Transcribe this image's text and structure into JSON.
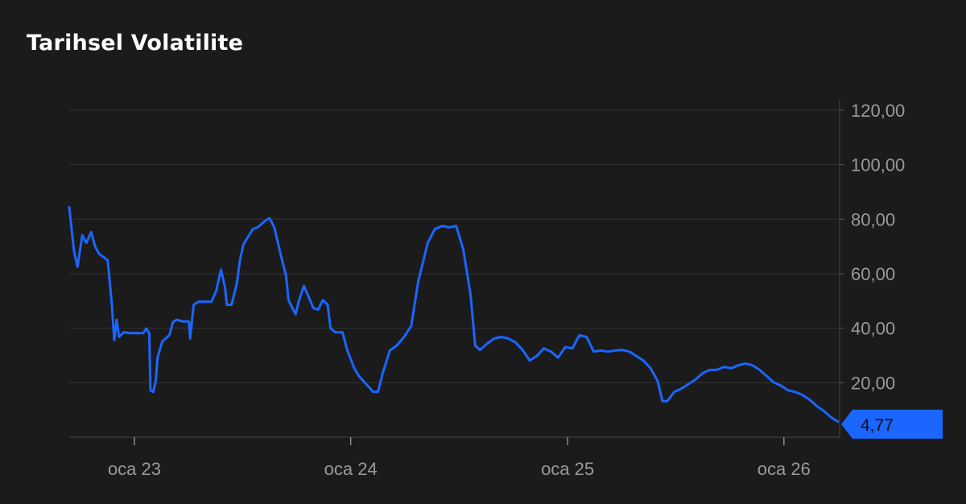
{
  "chart_data": {
    "type": "line",
    "title": "Tarihsel Volatilite",
    "xlabel": "",
    "ylabel": "",
    "ylim": [
      0,
      125
    ],
    "y_ticks": [
      20,
      40,
      60,
      80,
      100,
      120
    ],
    "y_tick_labels": [
      "20,00",
      "40,00",
      "60,00",
      "80,00",
      "100,00",
      "120,00"
    ],
    "x_ticks": [
      "2023-01-01",
      "2024-01-01",
      "2025-01-01",
      "2026-01-01"
    ],
    "x_tick_labels": [
      "oca 23",
      "oca 24",
      "oca 25",
      "oca 26"
    ],
    "xlim": [
      "2022-09-13",
      "2026-04-05"
    ],
    "grid": true,
    "line_color": "#1a66ff",
    "last_value": 4.77,
    "last_value_label": "4,77",
    "series": [
      {
        "points": [
          [
            "2022-09-13",
            84.4
          ],
          [
            "2022-09-21",
            68.3
          ],
          [
            "2022-09-27",
            62.6
          ],
          [
            "2022-10-05",
            74.1
          ],
          [
            "2022-10-12",
            71.3
          ],
          [
            "2022-10-20",
            75.3
          ],
          [
            "2022-10-27",
            69.8
          ],
          [
            "2022-11-03",
            67.2
          ],
          [
            "2022-11-10",
            66.1
          ],
          [
            "2022-11-17",
            64.9
          ],
          [
            "2022-11-24",
            48.6
          ],
          [
            "2022-11-28",
            35.6
          ],
          [
            "2022-12-02",
            43.1
          ],
          [
            "2022-12-06",
            36.8
          ],
          [
            "2022-12-14",
            38.5
          ],
          [
            "2022-12-26",
            38.2
          ],
          [
            "2023-01-08",
            38.2
          ],
          [
            "2023-01-16",
            38.2
          ],
          [
            "2023-01-21",
            39.9
          ],
          [
            "2023-01-26",
            38.2
          ],
          [
            "2023-01-28",
            17.2
          ],
          [
            "2023-02-02",
            16.6
          ],
          [
            "2023-02-06",
            20.6
          ],
          [
            "2023-02-09",
            29.2
          ],
          [
            "2023-02-17",
            35.2
          ],
          [
            "2023-03-01",
            37.4
          ],
          [
            "2023-03-07",
            42.2
          ],
          [
            "2023-03-13",
            43.1
          ],
          [
            "2023-03-23",
            42.5
          ],
          [
            "2023-04-03",
            42.5
          ],
          [
            "2023-04-05",
            36.2
          ],
          [
            "2023-04-11",
            48.6
          ],
          [
            "2023-04-19",
            49.7
          ],
          [
            "2023-04-29",
            49.7
          ],
          [
            "2023-05-11",
            49.7
          ],
          [
            "2023-05-19",
            53.7
          ],
          [
            "2023-05-27",
            61.5
          ],
          [
            "2023-06-03",
            54.9
          ],
          [
            "2023-06-06",
            48.6
          ],
          [
            "2023-06-14",
            48.6
          ],
          [
            "2023-06-23",
            56.6
          ],
          [
            "2023-06-28",
            64.9
          ],
          [
            "2023-07-04",
            70.7
          ],
          [
            "2023-07-12",
            73.6
          ],
          [
            "2023-07-20",
            76.4
          ],
          [
            "2023-07-28",
            77.0
          ],
          [
            "2023-08-09",
            79.3
          ],
          [
            "2023-08-17",
            80.4
          ],
          [
            "2023-08-25",
            77.0
          ],
          [
            "2023-09-06",
            66.1
          ],
          [
            "2023-09-14",
            59.2
          ],
          [
            "2023-09-18",
            50.3
          ],
          [
            "2023-09-30",
            45.1
          ],
          [
            "2023-10-06",
            50.3
          ],
          [
            "2023-10-14",
            55.5
          ],
          [
            "2023-10-22",
            51.5
          ],
          [
            "2023-10-30",
            47.4
          ],
          [
            "2023-11-07",
            46.8
          ],
          [
            "2023-11-15",
            50.3
          ],
          [
            "2023-11-23",
            48.6
          ],
          [
            "2023-11-28",
            40.0
          ],
          [
            "2023-12-06",
            38.5
          ],
          [
            "2023-12-18",
            38.5
          ],
          [
            "2023-12-26",
            32.0
          ],
          [
            "2024-01-07",
            25.3
          ],
          [
            "2024-01-15",
            22.4
          ],
          [
            "2024-01-27",
            19.5
          ],
          [
            "2024-02-08",
            16.6
          ],
          [
            "2024-02-16",
            16.6
          ],
          [
            "2024-02-24",
            23.5
          ],
          [
            "2024-03-07",
            31.8
          ],
          [
            "2024-03-19",
            33.7
          ],
          [
            "2024-03-31",
            36.8
          ],
          [
            "2024-04-12",
            40.8
          ],
          [
            "2024-04-24",
            57.2
          ],
          [
            "2024-05-10",
            71.3
          ],
          [
            "2024-05-22",
            76.4
          ],
          [
            "2024-06-03",
            77.5
          ],
          [
            "2024-06-15",
            77.0
          ],
          [
            "2024-06-27",
            77.5
          ],
          [
            "2024-07-09",
            68.9
          ],
          [
            "2024-07-21",
            52.6
          ],
          [
            "2024-07-29",
            33.7
          ],
          [
            "2024-08-06",
            32.0
          ],
          [
            "2024-08-18",
            34.3
          ],
          [
            "2024-08-30",
            36.2
          ],
          [
            "2024-09-11",
            36.8
          ],
          [
            "2024-09-23",
            36.2
          ],
          [
            "2024-10-05",
            34.8
          ],
          [
            "2024-10-17",
            32.0
          ],
          [
            "2024-10-29",
            28.1
          ],
          [
            "2024-11-10",
            29.8
          ],
          [
            "2024-11-22",
            32.6
          ],
          [
            "2024-12-04",
            31.4
          ],
          [
            "2024-12-16",
            29.2
          ],
          [
            "2024-12-28",
            33.1
          ],
          [
            "2025-01-09",
            32.6
          ],
          [
            "2025-01-21",
            37.4
          ],
          [
            "2025-02-02",
            36.8
          ],
          [
            "2025-02-14",
            31.4
          ],
          [
            "2025-02-26",
            31.8
          ],
          [
            "2025-03-10",
            31.4
          ],
          [
            "2025-03-22",
            31.8
          ],
          [
            "2025-04-03",
            32.0
          ],
          [
            "2025-04-15",
            31.4
          ],
          [
            "2025-04-27",
            29.8
          ],
          [
            "2025-05-09",
            28.1
          ],
          [
            "2025-05-21",
            25.3
          ],
          [
            "2025-06-02",
            20.6
          ],
          [
            "2025-06-10",
            13.2
          ],
          [
            "2025-06-18",
            13.2
          ],
          [
            "2025-06-30",
            16.6
          ],
          [
            "2025-07-12",
            17.8
          ],
          [
            "2025-07-24",
            19.5
          ],
          [
            "2025-08-05",
            21.2
          ],
          [
            "2025-08-17",
            23.5
          ],
          [
            "2025-08-29",
            24.7
          ],
          [
            "2025-09-10",
            24.7
          ],
          [
            "2025-09-22",
            25.8
          ],
          [
            "2025-10-04",
            25.3
          ],
          [
            "2025-10-16",
            26.4
          ],
          [
            "2025-10-28",
            27.0
          ],
          [
            "2025-11-09",
            26.4
          ],
          [
            "2025-11-21",
            24.7
          ],
          [
            "2025-12-03",
            22.4
          ],
          [
            "2025-12-15",
            20.1
          ],
          [
            "2025-12-27",
            18.9
          ],
          [
            "2026-01-08",
            17.2
          ],
          [
            "2026-01-20",
            16.6
          ],
          [
            "2026-02-01",
            15.5
          ],
          [
            "2026-02-13",
            13.8
          ],
          [
            "2026-02-25",
            11.5
          ],
          [
            "2026-03-09",
            9.7
          ],
          [
            "2026-03-21",
            7.4
          ],
          [
            "2026-04-02",
            5.7
          ]
        ]
      }
    ]
  }
}
